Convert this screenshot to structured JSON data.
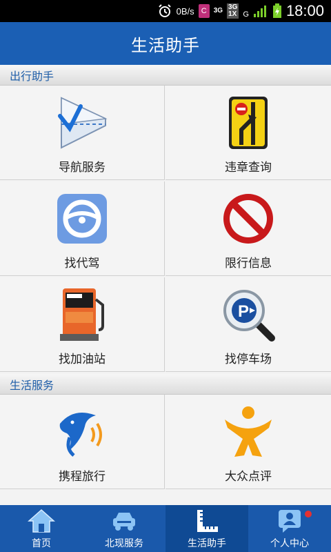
{
  "status_bar": {
    "speed": "0B/s",
    "badge": "C",
    "net_3g": "3G",
    "net_3g1x": "3G\n1X",
    "net_g": "G",
    "time": "18:00"
  },
  "header": {
    "title": "生活助手"
  },
  "sections": [
    {
      "title": "出行助手",
      "items": [
        {
          "label": "导航服务",
          "icon": "navigation-icon"
        },
        {
          "label": "违章查询",
          "icon": "traffic-sign-icon"
        },
        {
          "label": "找代驾",
          "icon": "steering-wheel-icon"
        },
        {
          "label": "限行信息",
          "icon": "no-entry-icon"
        },
        {
          "label": "找加油站",
          "icon": "gas-pump-icon"
        },
        {
          "label": "找停车场",
          "icon": "parking-search-icon"
        }
      ]
    },
    {
      "title": "生活服务",
      "items": [
        {
          "label": "携程旅行",
          "icon": "dolphin-icon"
        },
        {
          "label": "大众点评",
          "icon": "person-logo-icon"
        }
      ]
    }
  ],
  "bottom_nav": {
    "tabs": [
      {
        "label": "首页",
        "icon": "home-icon"
      },
      {
        "label": "北现服务",
        "icon": "car-icon"
      },
      {
        "label": "生活助手",
        "icon": "ruler-icon",
        "active": true
      },
      {
        "label": "个人中心",
        "icon": "profile-chat-icon"
      }
    ]
  },
  "colors": {
    "brand": "#1b5fb4",
    "section_text": "#1f5ea8"
  }
}
